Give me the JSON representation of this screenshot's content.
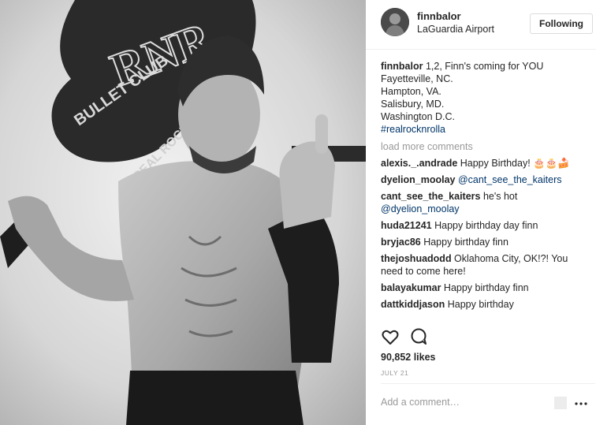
{
  "post": {
    "username": "finnbalor",
    "location": "LaGuardia Airport",
    "follow_label": "Following",
    "photo": {
      "guitar_text_1": "BULLET CLUB",
      "guitar_text_2": "RNR",
      "guitar_text_3": "REAL ROCK"
    },
    "caption": {
      "username": "finnbalor",
      "first_line": " 1,2, Finn's coming for YOU",
      "lines": [
        "Fayetteville, NC.",
        "Hampton, VA.",
        "Salisbury, MD.",
        "Washington D.C."
      ],
      "hashtag": "#realrocknrolla"
    },
    "load_more_label": "load more comments",
    "comments": [
      {
        "user": "alexis._.andrade",
        "text": " Happy Birthday! 🎂🎂🍰",
        "mention": ""
      },
      {
        "user": "dyelion_moolay",
        "text": " ",
        "mention": "@cant_see_the_kaiters"
      },
      {
        "user": "cant_see_the_kaiters",
        "text": " he's hot ",
        "mention": "@dyelion_moolay"
      },
      {
        "user": "huda21241",
        "text": " Happy birthday day finn",
        "mention": ""
      },
      {
        "user": "bryjac86",
        "text": " Happy birthday finn",
        "mention": ""
      },
      {
        "user": "thejoshuadodd",
        "text": " Oklahoma City, OK!?! You need to come here!",
        "mention": ""
      },
      {
        "user": "balayakumar",
        "text": " Happy birthday finn",
        "mention": ""
      },
      {
        "user": "dattkiddjason",
        "text": " Happy birthday",
        "mention": ""
      }
    ],
    "likes": "90,852 likes",
    "date": "JULY 21",
    "add_comment_placeholder": "Add a comment…",
    "icons": {
      "like": "heart-icon",
      "comment": "comment-icon",
      "more": "more-options-icon"
    }
  }
}
